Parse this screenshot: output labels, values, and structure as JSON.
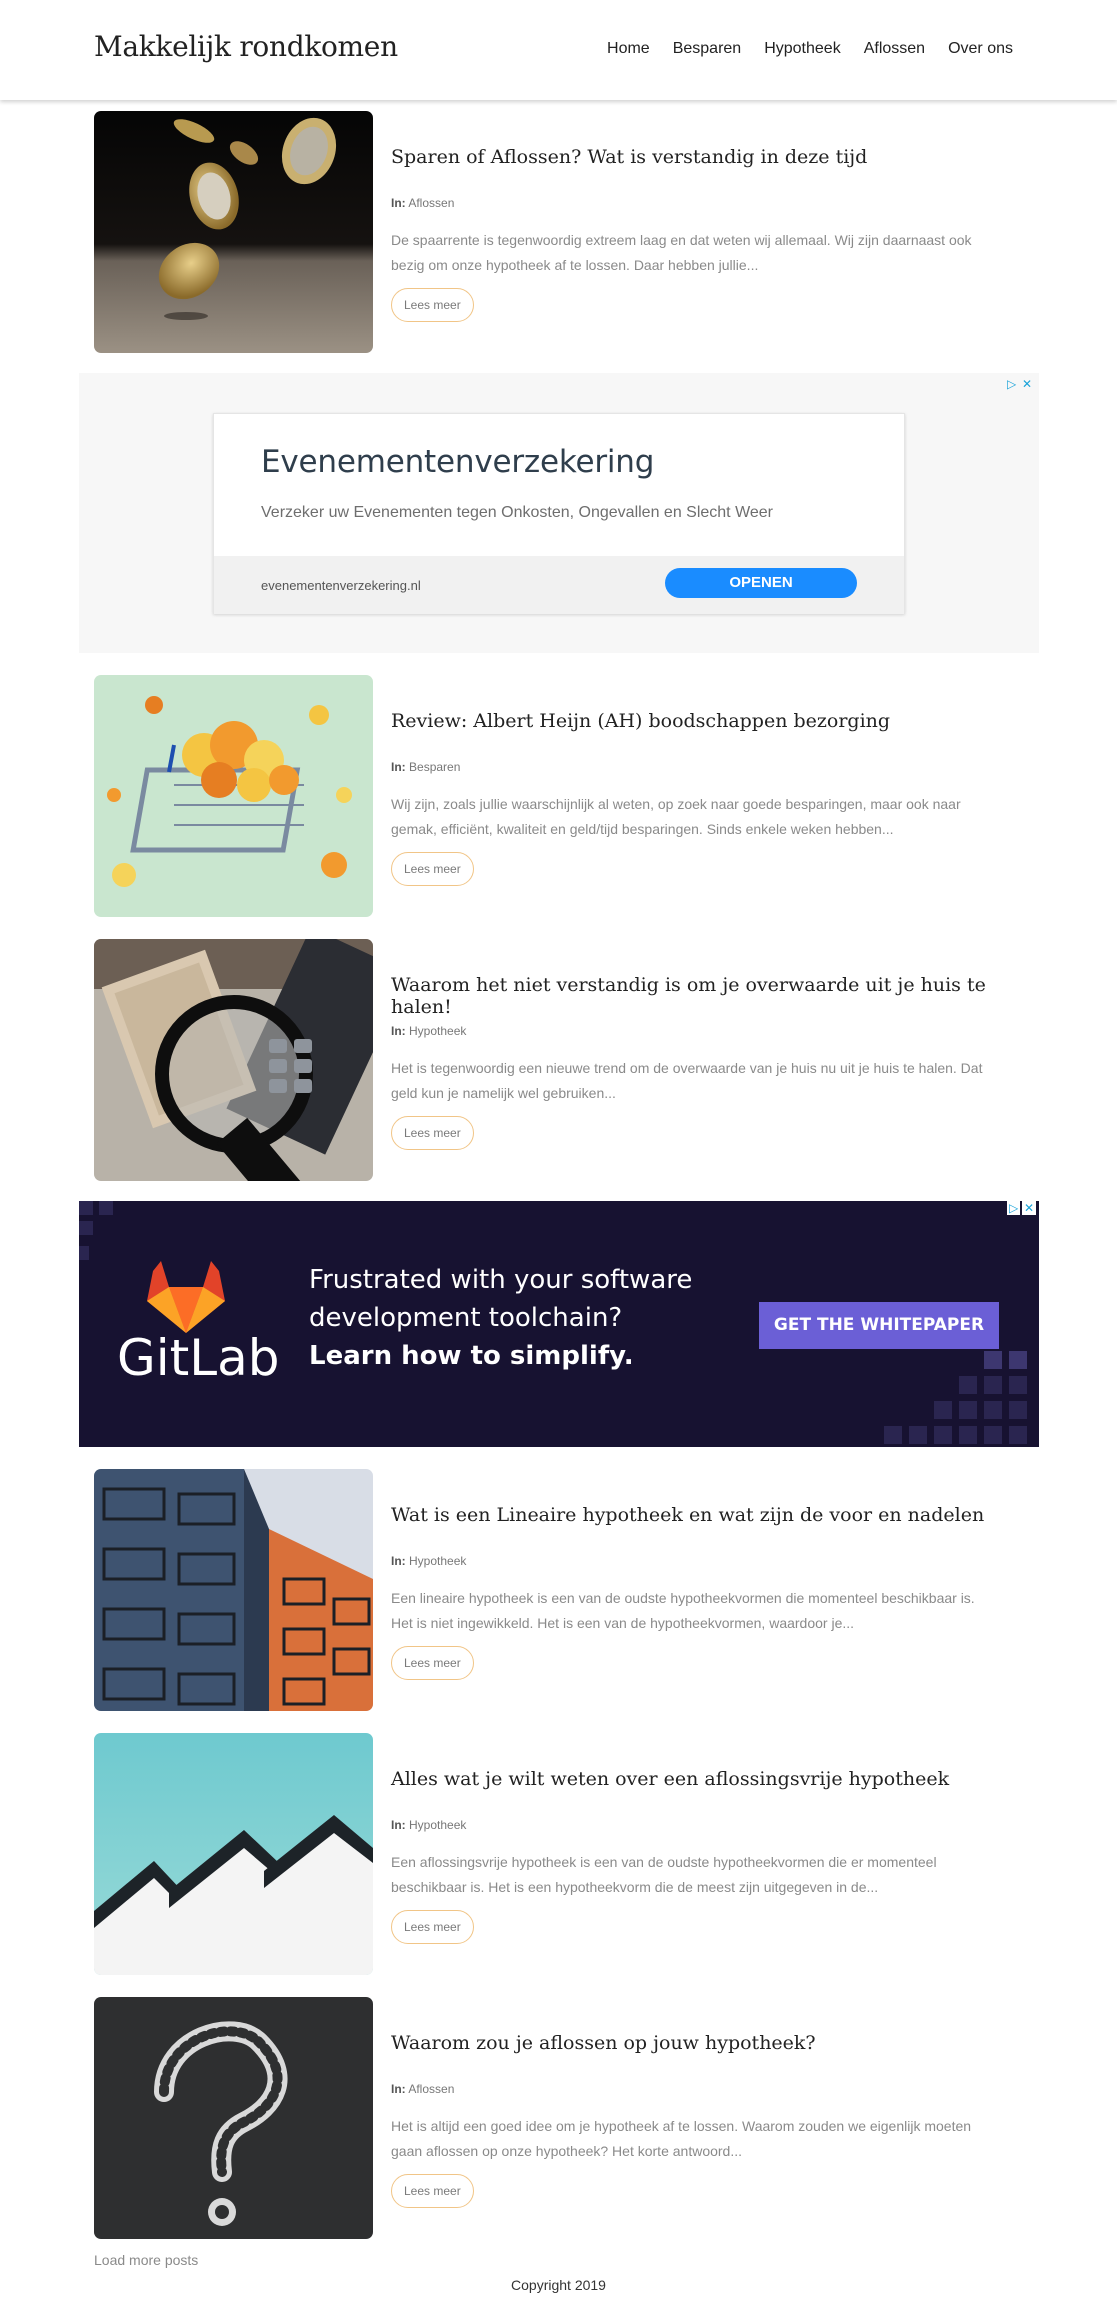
{
  "site": {
    "title": "Makkelijk rondkomen"
  },
  "nav": [
    "Home",
    "Besparen",
    "Hypotheek",
    "Aflossen",
    "Over ons"
  ],
  "category_prefix": "In:",
  "posts": [
    {
      "title": "Sparen of Aflossen? Wat is verstandig in deze tijd",
      "category": "Aflossen",
      "excerpt_lines": [
        "De spaarrente is tegenwoordig extreem laag en dat weten wij allemaal. Wij zijn daarnaast ook",
        "bezig om onze hypotheek af te lossen. Daar hebben jullie..."
      ],
      "read_more": "Lees meer",
      "image_icon": "falling-coins-photo"
    },
    {
      "title": "Review: Albert Heijn (AH) boodschappen bezorging",
      "category": "Besparen",
      "excerpt_lines": [
        "Wij zijn, zoals jullie waarschijnlijk al weten, op zoek naar goede besparingen, maar ook naar",
        "gemak, efficiënt, kwaliteit en geld/tijd besparingen. Sinds enkele weken hebben..."
      ],
      "read_more": "Lees meer",
      "image_icon": "pasta-shopping-basket-photo"
    },
    {
      "title": "Waarom het niet verstandig is om je overwaarde uit je huis te halen!",
      "category": "Hypotheek",
      "excerpt_lines": [
        "Het is tegenwoordig een nieuwe trend om de overwaarde van je huis nu uit je huis te halen. Dat",
        "geld kun je namelijk wel gebruiken..."
      ],
      "read_more": "Lees meer",
      "image_icon": "magnifier-calculator-money-photo"
    },
    {
      "title": "Wat is een Lineaire hypotheek en wat zijn de voor en nadelen",
      "category": "Hypotheek",
      "excerpt_lines": [
        "Een lineaire hypotheek is een van de oudste hypotheekvormen die momenteel beschikbaar is.",
        "Het is niet ingewikkeld. Het is een van de hypotheekvormen, waardoor je..."
      ],
      "read_more": "Lees meer",
      "image_icon": "apartment-balconies-photo"
    },
    {
      "title": "Alles wat je wilt weten over een aflossingsvrije hypotheek",
      "category": "Hypotheek",
      "excerpt_lines": [
        "Een aflossingsvrije hypotheek is een van de oudste hypotheekvormen die er momenteel",
        "beschikbaar is. Het is een hypotheekvorm die de meest zijn uitgegeven in de..."
      ],
      "read_more": "Lees meer",
      "image_icon": "house-rooftops-photo"
    },
    {
      "title": "Waarom zou je aflossen op jouw hypotheek?",
      "category": "Aflossen",
      "excerpt_lines": [
        "Het is altijd een goed idee om je hypotheek af te lossen. Waarom zouden we eigenlijk moeten",
        "gaan aflossen op onze hypotheek? Het korte antwoord..."
      ],
      "read_more": "Lees meer",
      "image_icon": "chalk-question-mark-photo"
    }
  ],
  "ad1": {
    "headline": "Evenementenverzekering",
    "description": "Verzeker uw Evenementen tegen Onkosten, Ongevallen en Slecht Weer",
    "url": "evenementenverzekering.nl",
    "button": "OPENEN",
    "choices_icon": "adchoices-icon",
    "close_icon": "close-icon"
  },
  "ad2": {
    "brand": "GitLab",
    "line1": "Frustrated with your software",
    "line2": "development toolchain?",
    "line3": "Learn how to simplify.",
    "button": "GET THE WHITEPAPER",
    "logo_icon": "gitlab-fox-icon"
  },
  "footer": {
    "load_more": "Load more posts",
    "copyright": "Copyright 2019"
  },
  "colors": {
    "accent_border": "#f1c587",
    "ad_button": "#1a8cff",
    "gitlab_bg": "#171231",
    "gitlab_button": "#6b5fd6"
  }
}
